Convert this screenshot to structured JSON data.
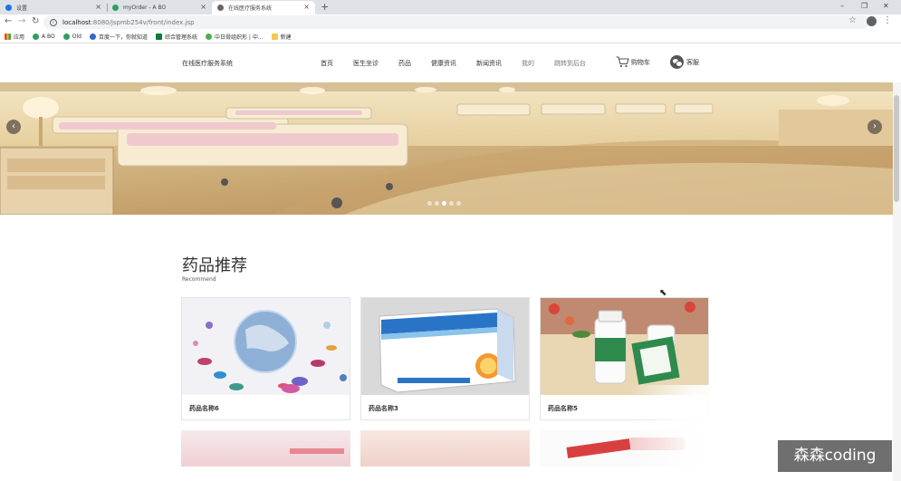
{
  "browser": {
    "tabs": [
      {
        "label": "设置"
      },
      {
        "label": "myOrder - A BO"
      },
      {
        "label": "在线医疗服务系统"
      }
    ],
    "url_host": "localhost",
    "url_path": ":8080/jspmb254v/front/index.jsp",
    "bookmarks": [
      "应用",
      "A BO",
      "Old",
      "百度一下，你就知道",
      "综合管理系统",
      "中日骨组织形 | 中...",
      "新建"
    ]
  },
  "site": {
    "title": "在线医疗服务系统",
    "nav": [
      "首页",
      "医生坐诊",
      "药品",
      "健康资讯",
      "新闻资讯",
      "我的",
      "跳转到后台"
    ],
    "cart_label": "购物车",
    "service_label": "客服"
  },
  "carousel": {
    "slide_count": 5,
    "active_index": 2
  },
  "recommend": {
    "title": "药品推荐",
    "subtitle": "Recommend",
    "items": [
      {
        "name": "药品名称6"
      },
      {
        "name": "药品名称3"
      },
      {
        "name": "药品名称5"
      }
    ]
  },
  "watermark": "森森coding"
}
